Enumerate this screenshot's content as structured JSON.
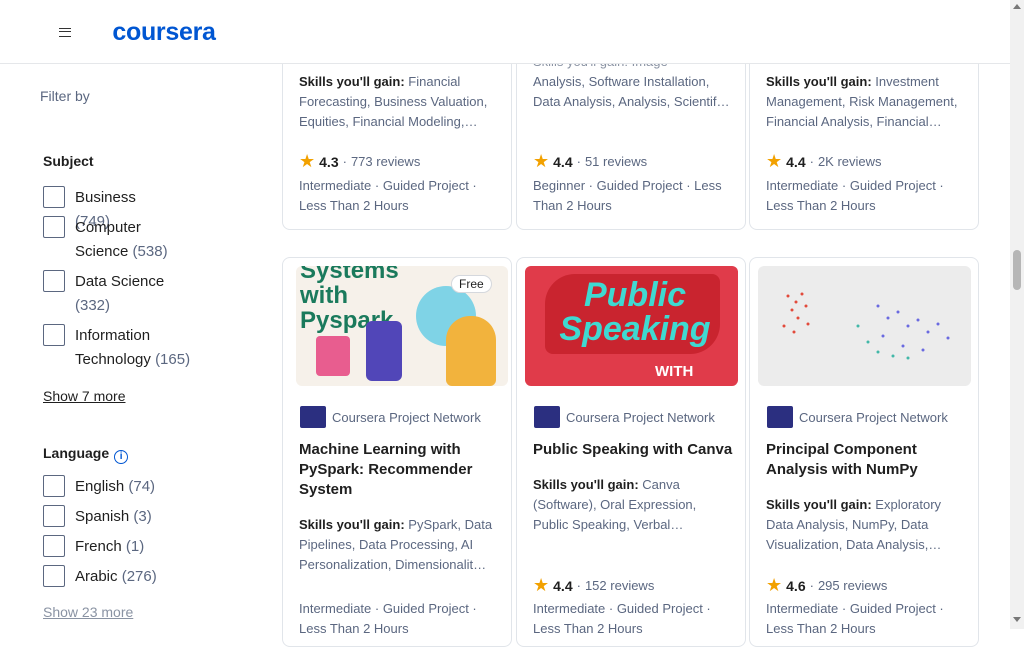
{
  "header": {
    "logo": "coursera"
  },
  "filters": {
    "title": "Filter by",
    "subject": {
      "title": "Subject",
      "options": [
        {
          "label": "Business",
          "count": "(749)"
        },
        {
          "label": "Computer Science",
          "count": "(538)"
        },
        {
          "label": "Data Science",
          "count": "(332)"
        },
        {
          "label": "Information Technology",
          "count": "(165)"
        }
      ],
      "show_more": "Show 7 more"
    },
    "language": {
      "title": "Language",
      "info": "i",
      "options": [
        {
          "label": "English",
          "count": "(74)"
        },
        {
          "label": "Spanish",
          "count": "(3)"
        },
        {
          "label": "French",
          "count": "(1)"
        },
        {
          "label": "Arabic",
          "count": "(276)"
        }
      ],
      "show_more": "Show 23 more"
    }
  },
  "cards_top": [
    {
      "skills_label": "Skills you'll gain:",
      "skills": "Financial Forecasting, Business Valuation, Equities, Financial Modeling,…",
      "rating": "4.3",
      "reviews": "773 reviews",
      "meta": "Intermediate · Guided Project · Less Than 2 Hours"
    },
    {
      "skills_partial": "Skills you'll gain: Image",
      "skills": "Analysis, Software Installation, Data Analysis, Analysis, Scientif…",
      "rating": "4.4",
      "reviews": "51 reviews",
      "meta": "Beginner · Guided Project · Less Than 2 Hours"
    },
    {
      "skills_label": "Skills you'll gain:",
      "skills": "Investment Management, Risk Management, Financial Analysis, Financial…",
      "rating": "4.4",
      "reviews": "2K reviews",
      "meta": "Intermediate · Guided Project · Less Than 2 Hours"
    }
  ],
  "cards_bottom": [
    {
      "badge": "Free",
      "thumb_text": "Systems with Pyspark",
      "partner": "Coursera Project Network",
      "title": "Machine Learning with PySpark: Recommender System",
      "skills_label": "Skills you'll gain:",
      "skills": "PySpark, Data Pipelines, Data Processing, AI Personalization, Dimensionalit…",
      "rating": "4.4",
      "reviews": "152 reviews",
      "meta": "Intermediate · Guided Project · Less Than 2 Hours"
    },
    {
      "thumb_text": "Public Speaking",
      "thumb_sub": "WITH",
      "partner": "Coursera Project Network",
      "title": "Public Speaking with Canva",
      "skills_label": "Skills you'll gain:",
      "skills": "Canva (Software), Oral Expression, Public Speaking, Verbal…",
      "rating": "4.4",
      "reviews": "152 reviews",
      "meta": "Intermediate · Guided Project · Less Than 2 Hours"
    },
    {
      "partner": "Coursera Project Network",
      "title": "Principal Component Analysis with NumPy",
      "skills_label": "Skills you'll gain:",
      "skills": "Exploratory Data Analysis, NumPy, Data Visualization, Data Analysis,…",
      "rating": "4.6",
      "reviews": "295 reviews",
      "meta": "Intermediate · Guided Project · Less Than 2 Hours"
    }
  ],
  "colors": {
    "brand": "#0056d2",
    "star": "#f2a100",
    "muted": "#5b6780"
  }
}
